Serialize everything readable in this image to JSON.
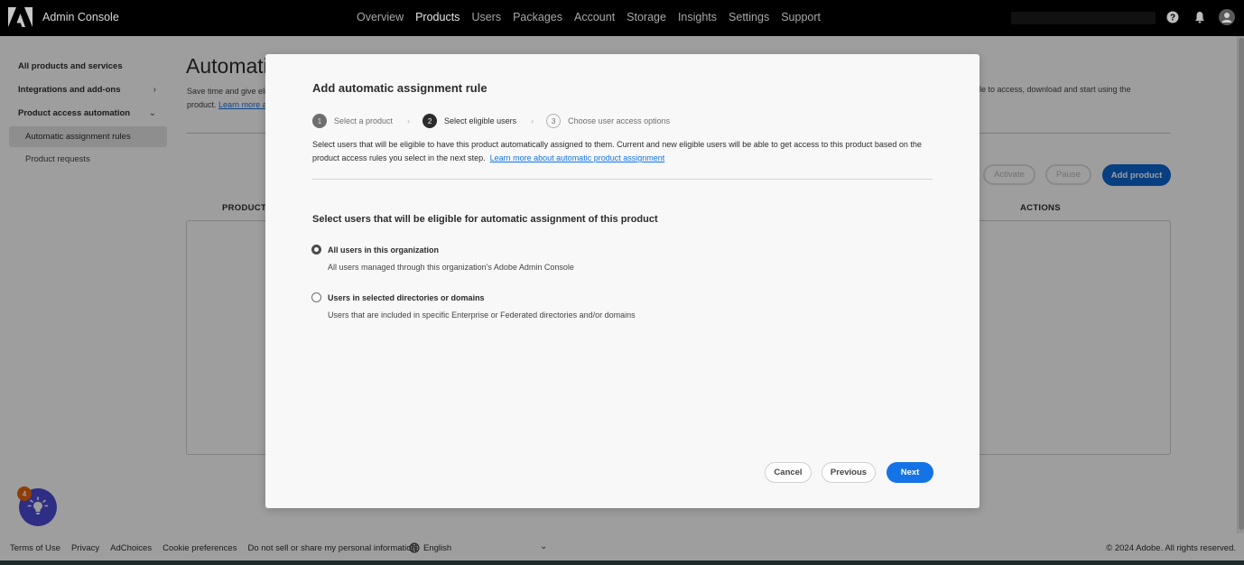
{
  "header": {
    "app_title": "Admin Console",
    "nav": [
      "Overview",
      "Products",
      "Users",
      "Packages",
      "Account",
      "Storage",
      "Insights",
      "Settings",
      "Support"
    ],
    "active_nav": "Products",
    "icons": [
      "help-icon",
      "bell-icon",
      "avatar-icon"
    ]
  },
  "sidebar": {
    "items": [
      {
        "label": "All products and services"
      },
      {
        "label": "Integrations and add-ons",
        "chevron": "›"
      },
      {
        "label": "Product access automation",
        "chevron": "⌄"
      }
    ],
    "sub_items": [
      {
        "label": "Automatic assignment rules",
        "selected": true
      },
      {
        "label": "Product requests",
        "selected": false
      }
    ]
  },
  "page": {
    "title": "Automatic a",
    "desc_start": "Save time and give eli",
    "desc_link": "Learn more a",
    "desc_line2_start": "product.",
    "desc_right": "ble to access, download and start using the",
    "buttons": {
      "activate": "Activate",
      "pause": "Pause",
      "add_product": "Add product"
    },
    "table_headers": {
      "product": "PRODUCT",
      "actions": "ACTIONS"
    }
  },
  "modal": {
    "title": "Add automatic assignment rule",
    "steps": [
      {
        "num": "1",
        "label": "Select a product",
        "state": "done"
      },
      {
        "num": "2",
        "label": "Select eligible users",
        "state": "current"
      },
      {
        "num": "3",
        "label": "Choose user access options",
        "state": "pending"
      }
    ],
    "step_separator": "›",
    "intro": "Select users that will be eligible to have this product automatically assigned to them. Current and new eligible users will be able to get access to this product based on the product access rules you select in the next step.",
    "intro_link": "Learn more about automatic product assignment",
    "section_title": "Select users that will be eligible for automatic assignment of this product",
    "options": [
      {
        "label": "All users in this organization",
        "desc": "All users managed through this organization's Adobe Admin Console",
        "checked": true
      },
      {
        "label": "Users in selected directories or domains",
        "desc": "Users that are included in specific Enterprise or Federated directories and/or domains",
        "checked": false
      }
    ],
    "buttons": {
      "cancel": "Cancel",
      "previous": "Previous",
      "next": "Next"
    }
  },
  "footer": {
    "links": [
      "Terms of Use",
      "Privacy",
      "AdChoices",
      "Cookie preferences",
      "Do not sell or share my personal information"
    ],
    "language": "English",
    "copyright": "© 2024 Adobe. All rights reserved."
  },
  "help_fab": {
    "badge": "4"
  },
  "colors": {
    "accent": "#1473e6",
    "badge": "#e8630a",
    "fab": "#4b4bd6"
  }
}
